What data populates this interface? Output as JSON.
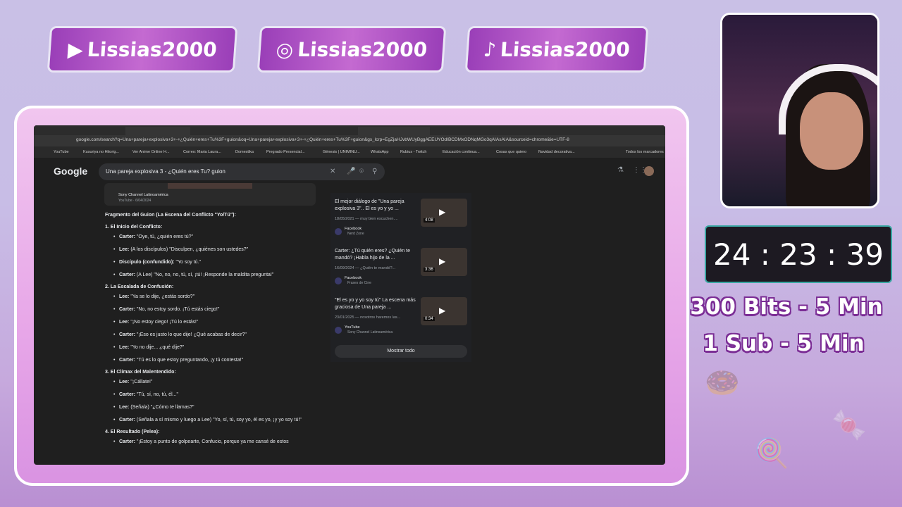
{
  "socials": [
    {
      "icon": "youtube-icon",
      "handle": "Lissias2000"
    },
    {
      "icon": "instagram-icon",
      "handle": "Lissias2000"
    },
    {
      "icon": "tiktok-icon",
      "handle": "Lissias2000"
    }
  ],
  "browser": {
    "url": "google.com/search?q=Una+pareja+explosiva+3+-+¿Quién+eres+Tu%3F+guion&oq=Una+pareja+explosiva+3+-+¿Quién+eres+Tu%3F+guion&gs_lcrp=EgZjaHJvbWUyBggAEEUYOdIBCDMxODNqMGo3qAIAsAIA&sourceid=chrome&ie=UTF-8",
    "bookmarks": [
      "YouTube",
      "Kusuriya no Hitorig...",
      "Ver Anime Online H...",
      "Correo: Maria Laura...",
      "Domestika",
      "Pregrado Presencial...",
      "Génesis | UNIMINU...",
      "WhatsApp",
      "Rubius - Twitch",
      "Educación continua...",
      "Cosas que quiero",
      "Navidad decorativa...",
      "Todos los marcadores"
    ]
  },
  "google": {
    "logo": "Google",
    "query": "Una pareja explosiva 3 - ¿Quién eres Tu? guion"
  },
  "video_card": {
    "channel": "Sony Channel Latinoamérica",
    "meta": "YouTube · 6/04/2024"
  },
  "script": {
    "title": "Fragmento del Guion (La Escena del Conflicto \"Yo/Tú\"):",
    "sections": [
      {
        "heading": "1. El Inicio del Conflicto:",
        "lines": [
          {
            "who": "Carter:",
            "text": " \"Oye, tú, ¿quién eres tú?\""
          },
          {
            "who": "Lee:",
            "text": " (A los discípulos) \"Disculpen, ¿quiénes son ustedes?\""
          },
          {
            "who": "Discípulo (confundido):",
            "text": " \"Yo soy tú.\""
          },
          {
            "who": "Carter:",
            "text": " (A Lee) \"No, no, no, tú, sí, ¡tú! ¡Responde la maldita pregunta!\""
          }
        ]
      },
      {
        "heading": "2. La Escalada de Confusión:",
        "lines": [
          {
            "who": "Lee:",
            "text": " \"Ya se lo dije, ¿estás sordo?\""
          },
          {
            "who": "Carter:",
            "text": " \"No, no estoy sordo. ¡Tú estás ciego!\""
          },
          {
            "who": "Lee:",
            "text": " \"¡No estoy ciego! ¡Tú lo estás!\""
          },
          {
            "who": "Carter:",
            "text": " \"¡Eso es justo lo que dije! ¿Qué acabas de decir?\""
          },
          {
            "who": "Lee:",
            "text": " \"Yo no dije... ¿qué dije?\""
          },
          {
            "who": "Carter:",
            "text": " \"Tú es lo que estoy preguntando, ¡y tú contesta!\""
          }
        ]
      },
      {
        "heading": "3. El Clímax del Malentendido:",
        "lines": [
          {
            "who": "Lee:",
            "text": " \"¡Cállate!\""
          },
          {
            "who": "Carter:",
            "text": " \"Tú, sí, no, tú, él...\""
          },
          {
            "who": "Lee:",
            "text": " (Señala) \"¿Cómo te llamas?\""
          },
          {
            "who": "Carter:",
            "text": " (Señala a sí mismo y luego a Lee) \"Yo, sí, tú, soy yo, él es yo, ¡y yo soy tú!\""
          }
        ]
      },
      {
        "heading": "4. El Resultado (Pelea):",
        "lines": [
          {
            "who": "Carter:",
            "text": " \"¡Estoy a punto de golpearte, Confucio, porque ya me cansé de estos"
          }
        ]
      }
    ]
  },
  "side_videos": [
    {
      "title": "El mejor diálogo de \"Una pareja explosiva 3\".. El es yo y yo ...",
      "desc": "18/05/2021 — muy bien escuchen....",
      "source": "Facebook",
      "source2": "Nerd Zone",
      "duration": "4:08"
    },
    {
      "title": "Carter: ¿Tú quién eres? ¿Quién te mandó? ¡Habla hijo de la ...",
      "desc": "16/09/2024 — ¿Quién te mandó?...",
      "source": "Facebook",
      "source2": "Frases de Cine",
      "duration": "3:36"
    },
    {
      "title": "\"El es yo y yo soy tú\" La escena más graciosa de Una pareja ...",
      "desc": "23/01/2025 — nosotros haremos las...",
      "source": "YouTube",
      "source2": "Sony Channel Latinoamérica",
      "duration": "0:34"
    }
  ],
  "show_all": "Mostrar todo",
  "timer": "24 : 23 : 39",
  "goals": [
    "300 Bits - 5 Min",
    "1 Sub - 5 Min"
  ]
}
